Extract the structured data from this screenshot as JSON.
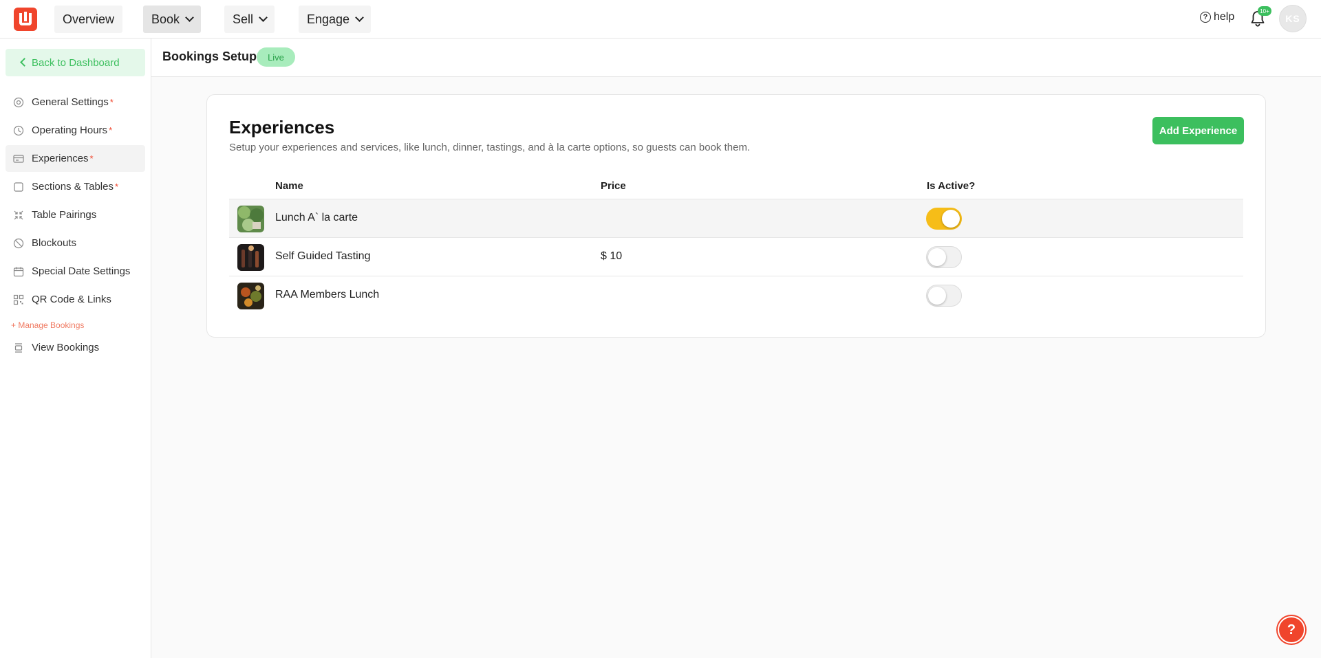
{
  "topbar": {
    "nav": [
      {
        "label": "Overview",
        "has_dropdown": false,
        "active": false
      },
      {
        "label": "Book",
        "has_dropdown": true,
        "active": true
      },
      {
        "label": "Sell",
        "has_dropdown": true,
        "active": false
      },
      {
        "label": "Engage",
        "has_dropdown": true,
        "active": false
      }
    ],
    "help_label": "help",
    "notification_count": "10+",
    "avatar_initials": "KS"
  },
  "sidebar": {
    "back_label": "Back to Dashboard",
    "items": [
      {
        "label": "General Settings",
        "required": "*",
        "icon": "gear-icon"
      },
      {
        "label": "Operating Hours",
        "required": "*",
        "icon": "clock-icon"
      },
      {
        "label": "Experiences",
        "required": "*",
        "icon": "card-icon"
      },
      {
        "label": "Sections & Tables",
        "required": "*",
        "icon": "square-icon"
      },
      {
        "label": "Table Pairings",
        "required": "",
        "icon": "compress-icon"
      },
      {
        "label": "Blockouts",
        "required": "",
        "icon": "ban-icon"
      },
      {
        "label": "Special Date Settings",
        "required": "",
        "icon": "calendar-icon"
      },
      {
        "label": "QR Code & Links",
        "required": "",
        "icon": "qr-icon"
      }
    ],
    "manage_label": "+ Manage Bookings",
    "view_bookings_label": "View Bookings"
  },
  "header": {
    "title": "Bookings Setup",
    "status": "Live"
  },
  "experiences": {
    "title": "Experiences",
    "description": "Setup your experiences and services, like lunch, dinner, tastings, and à la carte options, so guests can book them.",
    "add_button": "Add Experience",
    "columns": [
      "Name",
      "Price",
      "Is Active?"
    ],
    "rows": [
      {
        "name": "Lunch A` la carte",
        "price": "",
        "active": true
      },
      {
        "name": "Self Guided Tasting",
        "price": "$ 10",
        "active": false
      },
      {
        "name": "RAA Members Lunch",
        "price": "",
        "active": false
      }
    ]
  },
  "fab_label": "?",
  "colors": {
    "brand": "#f0452c",
    "accent_green": "#3cbf5e",
    "toggle_on": "#f6bd18"
  }
}
